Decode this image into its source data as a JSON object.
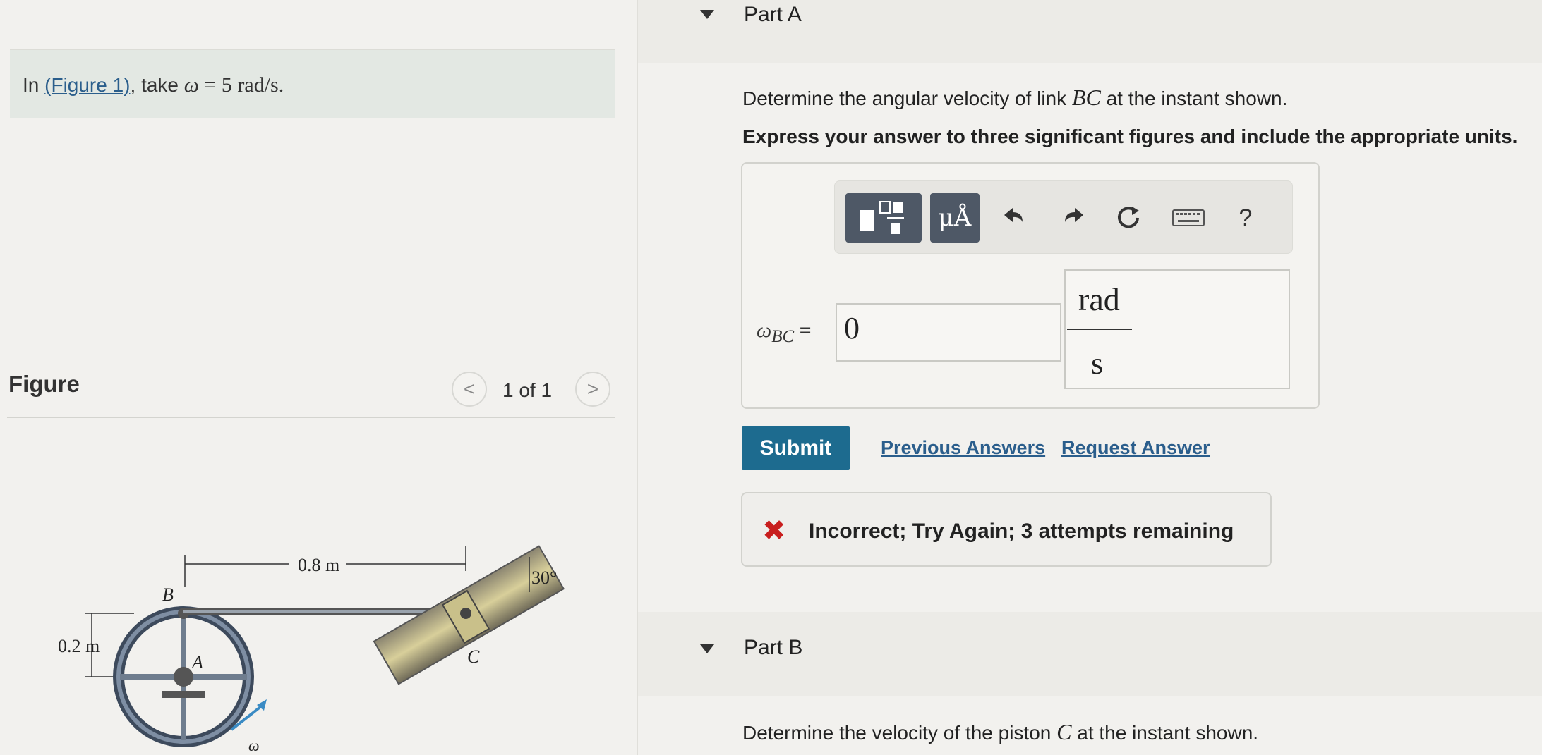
{
  "problem": {
    "prefix": "In ",
    "figure_link": "(Figure 1)",
    "middle": ", take ",
    "omega_symbol": "ω",
    "equals": " = ",
    "value": "5 rad/s."
  },
  "figure_panel": {
    "label": "Figure",
    "counter": "1 of 1",
    "prev_glyph": "<",
    "next_glyph": ">"
  },
  "figure": {
    "dim_horizontal": "0.8 m",
    "dim_vertical": "0.2 m",
    "angle": "30°",
    "label_B": "B",
    "label_A": "A",
    "label_C": "C",
    "label_omega": "ω"
  },
  "partA": {
    "title": "Part A",
    "question_prefix": "Determine the angular velocity of link ",
    "question_link": "BC",
    "question_suffix": " at the instant shown.",
    "instruction": "Express your answer to three significant figures and include the appropriate units.",
    "toolbar": {
      "units_label": "μÅ",
      "undo_icon": "undo-icon",
      "redo_icon": "redo-icon",
      "reset_icon": "reset-icon",
      "keyboard_icon": "keyboard-icon",
      "help_label": "?"
    },
    "answer": {
      "symbol": "ω",
      "subscript": "BC",
      "equals": "=",
      "value": "0",
      "unit_numerator": "rad",
      "unit_denominator": "s"
    },
    "submit_label": "Submit",
    "previous_answers_label": "Previous Answers",
    "request_answer_label": "Request Answer",
    "feedback": {
      "icon": "✖",
      "text": "Incorrect; Try Again; 3 attempts remaining"
    }
  },
  "partB": {
    "title": "Part B",
    "question_prefix": "Determine the velocity of the piston ",
    "question_var": "C",
    "question_suffix": " at the instant shown."
  },
  "colors": {
    "submit_bg": "#1d6b8f",
    "link": "#2b5e8c",
    "error": "#c81e1e",
    "toolbar_dark": "#4e5866"
  }
}
